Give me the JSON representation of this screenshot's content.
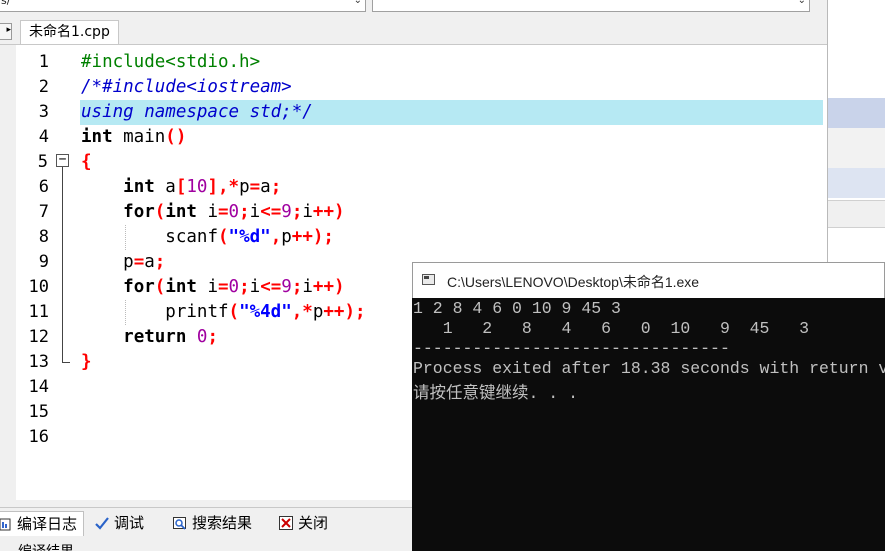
{
  "top_combo": {
    "left_text": "s/"
  },
  "file_tab": {
    "label": "未命名1.cpp"
  },
  "line_numbers": [
    "1",
    "2",
    "3",
    "4",
    "5",
    "6",
    "7",
    "8",
    "9",
    "10",
    "11",
    "12",
    "13",
    "14",
    "15",
    "16"
  ],
  "fold_marker": "−",
  "code": {
    "l1_pp": "#include<stdio.h>",
    "l2_cm": "/*#include<iostream>",
    "l3_cm": "using namespace std;*/",
    "l4_kw": "int",
    "l4_rest": " main",
    "l4_op": "()",
    "l5_op": "{",
    "l6_kw": "int",
    "l6_a": " a",
    "l6_o1": "[",
    "l6_n": "10",
    "l6_o2": "],*",
    "l6_b": "p",
    "l6_o3": "=",
    "l6_c": "a",
    "l6_o4": ";",
    "l7_kw1": "for",
    "l7_o1": "(",
    "l7_kw2": "int",
    "l7_a": " i",
    "l7_o2": "=",
    "l7_n1": "0",
    "l7_o3": ";",
    "l7_b": "i",
    "l7_o4": "<=",
    "l7_n2": "9",
    "l7_o5": ";",
    "l7_c": "i",
    "l7_o6": "++)",
    "l8_a": "scanf",
    "l8_o1": "(",
    "l8_s": "\"%d\"",
    "l8_o2": ",",
    "l8_b": "p",
    "l8_o3": "++);",
    "l9_a": "p",
    "l9_o1": "=",
    "l9_b": "a",
    "l9_o2": ";",
    "l11_a": "printf",
    "l11_o1": "(",
    "l11_s": "\"%4d\"",
    "l11_o2": ",*",
    "l11_b": "p",
    "l11_o3": "++);",
    "l12_kw": "return",
    "l12_n": " 0",
    "l12_o": ";",
    "l13_op": "}"
  },
  "bottom_tabs": {
    "compile_log": "编译日志",
    "debug": "调试",
    "search_results": "搜索结果",
    "close": "关闭"
  },
  "result_strip": "编译结果",
  "console": {
    "title": "C:\\Users\\LENOVO\\Desktop\\未命名1.exe",
    "lines": [
      "1 2 8 4 6 0 10 9 45 3",
      "   1   2   8   4   6   0  10   9  45   3",
      "--------------------------------",
      "Process exited after 18.38 seconds with return v",
      "请按任意键继续. . ."
    ]
  },
  "colors": {
    "highlight_row": "#b6e9f3",
    "preprocessor": "#008000",
    "comment": "#0000cc",
    "number": "#a000a0",
    "operator": "#ff0000",
    "string": "#0000ff",
    "console_bg": "#0c0c0c"
  }
}
